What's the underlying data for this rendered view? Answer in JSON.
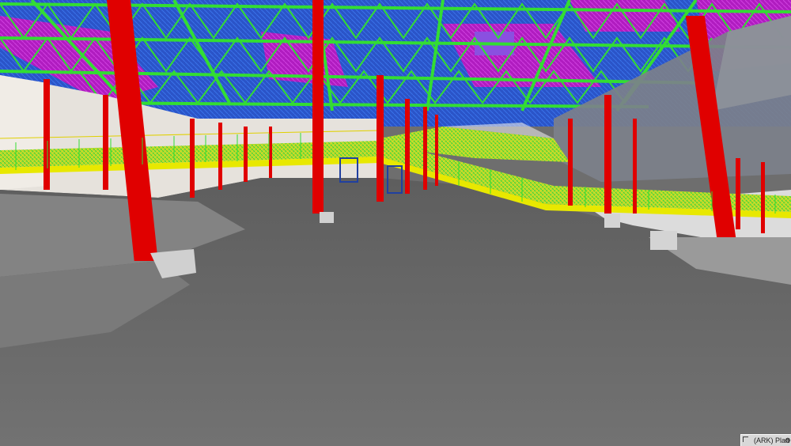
{
  "status_bar": {
    "view_name": "(ARK) Plan",
    "corner_icon": "view-corner-icon",
    "settings_icon": "settings-icon"
  },
  "scene": {
    "description_icon": "3d-bim-viewport",
    "colors": {
      "floor": "#6e6e6e",
      "column": "#e00000",
      "truss": "#33dd33",
      "deck_blue": "#2050c8",
      "deck_magenta": "#c020c8",
      "walkway": "#d8e000",
      "wall": "#e8e4de"
    }
  }
}
